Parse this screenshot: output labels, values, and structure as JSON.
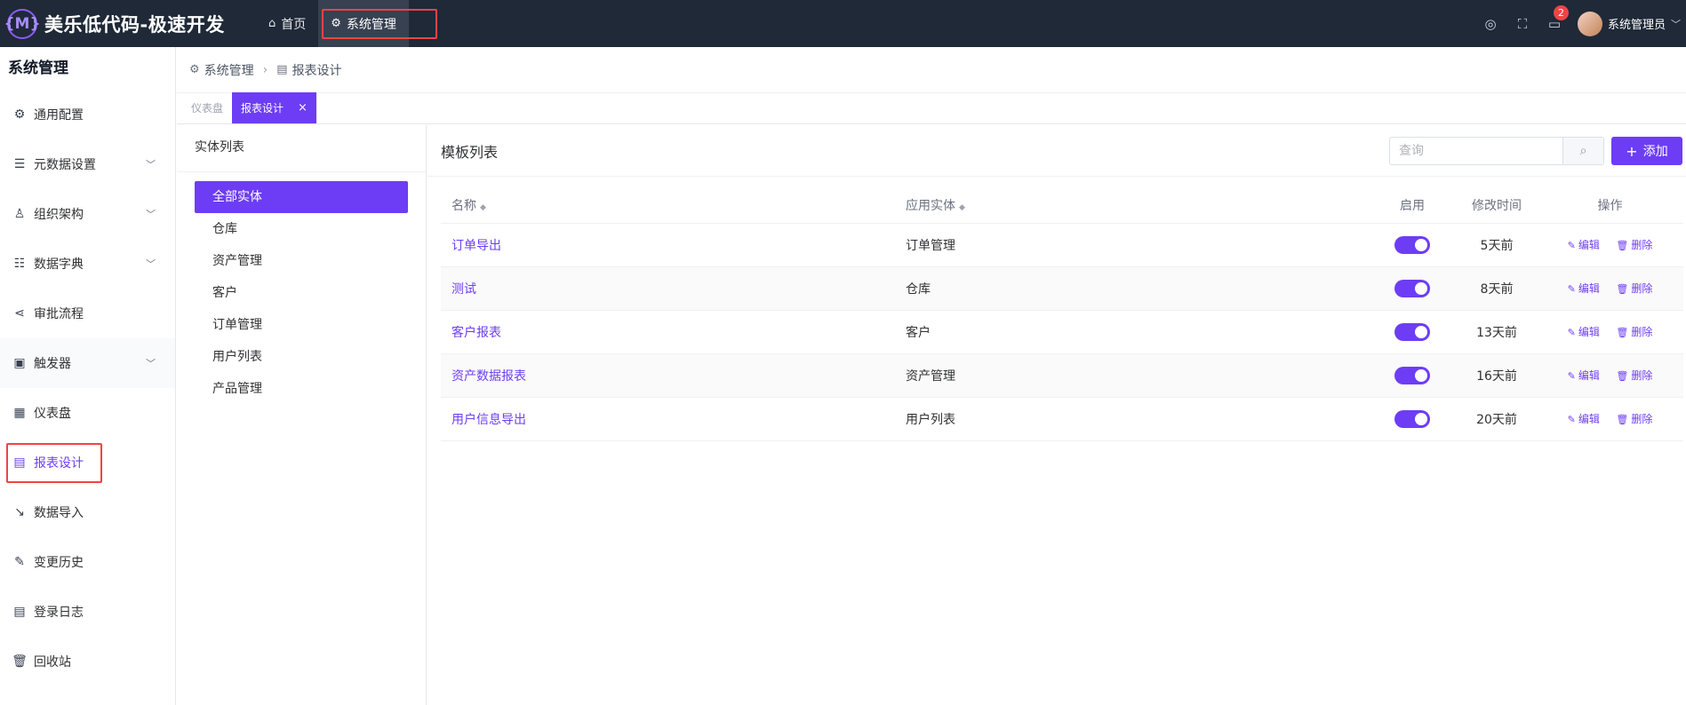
{
  "app": {
    "logo_mark": "{M}",
    "title": "美乐低代码-极速开发"
  },
  "topnav": [
    {
      "icon": "home-icon",
      "label": "首页"
    },
    {
      "icon": "gear-icon",
      "label": "系统管理"
    }
  ],
  "topright": {
    "badge": "2",
    "username": "系统管理员"
  },
  "sidebar": {
    "title": "系统管理",
    "items": [
      {
        "icon": "gear-icon",
        "label": "通用配置"
      },
      {
        "icon": "database-icon",
        "label": "元数据设置"
      },
      {
        "icon": "user-icon",
        "label": "组织架构"
      },
      {
        "icon": "sliders-icon",
        "label": "数据字典"
      },
      {
        "icon": "share-icon",
        "label": "审批流程"
      },
      {
        "icon": "chip-icon",
        "label": "触发器"
      },
      {
        "icon": "grid-icon",
        "label": "仪表盘"
      },
      {
        "icon": "report-icon",
        "label": "报表设计"
      },
      {
        "icon": "import-icon",
        "label": "数据导入"
      },
      {
        "icon": "edit-icon",
        "label": "变更历史"
      },
      {
        "icon": "log-icon",
        "label": "登录日志"
      },
      {
        "icon": "trash-icon",
        "label": "回收站"
      }
    ]
  },
  "breadcrumb": {
    "first": "系统管理",
    "second": "报表设计"
  },
  "tabs": [
    {
      "label": "仪表盘"
    },
    {
      "label": "报表设计"
    }
  ],
  "entity_panel": {
    "title": "实体列表",
    "items": [
      "全部实体",
      "仓库",
      "资产管理",
      "客户",
      "订单管理",
      "用户列表",
      "产品管理"
    ]
  },
  "template_list": {
    "title": "模板列表",
    "search_placeholder": "查询",
    "add_label": "添加",
    "columns": {
      "name": "名称",
      "entity": "应用实体",
      "enabled": "启用",
      "modified": "修改时间",
      "ops": "操作"
    },
    "edit_label": "编辑",
    "delete_label": "删除",
    "rows": [
      {
        "name": "订单导出",
        "entity": "订单管理",
        "enabled": true,
        "modified": "5天前"
      },
      {
        "name": "测试",
        "entity": "仓库",
        "enabled": true,
        "modified": "8天前"
      },
      {
        "name": "客户报表",
        "entity": "客户",
        "enabled": true,
        "modified": "13天前"
      },
      {
        "name": "资产数据报表",
        "entity": "资产管理",
        "enabled": true,
        "modified": "16天前"
      },
      {
        "name": "用户信息导出",
        "entity": "用户列表",
        "enabled": true,
        "modified": "20天前"
      }
    ]
  },
  "colors": {
    "accent": "#6d3df5",
    "topbar": "#1f2937",
    "highlight": "#ef4444"
  }
}
